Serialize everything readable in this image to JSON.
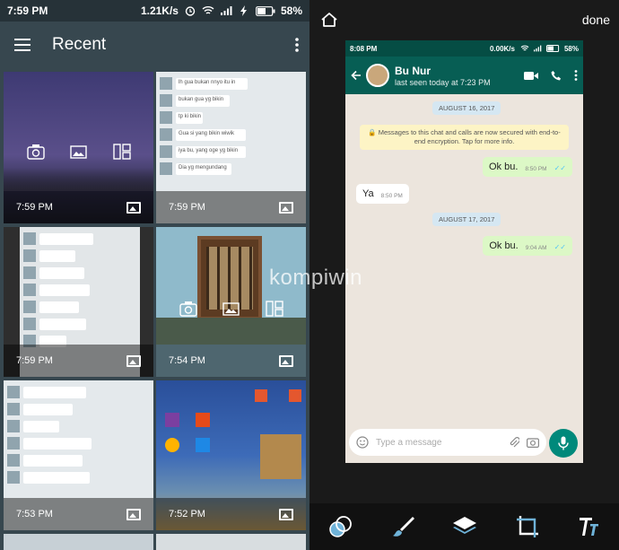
{
  "left": {
    "status": {
      "time": "7:59 PM",
      "speed": "1.21K/s",
      "battery": "58%"
    },
    "appbar": {
      "title": "Recent"
    },
    "tiles": [
      {
        "time": "7:59 PM"
      },
      {
        "time": "7:59 PM"
      },
      {
        "time": "7:59 PM"
      },
      {
        "time": "7:54 PM"
      },
      {
        "time": "7:53 PM"
      },
      {
        "time": "7:52 PM"
      }
    ],
    "thumb_chat_lines": [
      "lh gua bukan nnyo itu in",
      "bukan gua yg bikin",
      "tp ki bikin",
      "Gua si yang bikin wiwik",
      "iya bu, yang oge yg bikin",
      "Dia yg mengundang"
    ]
  },
  "right": {
    "done_label": "done",
    "phone": {
      "status_time": "8:08 PM",
      "status_speed": "0.00K/s",
      "status_battery": "58%",
      "contact_name": "Bu Nur",
      "last_seen": "last seen today at 7:23 PM",
      "date1": "AUGUST 16, 2017",
      "encryption": "Messages to this chat and calls are now secured with end-to-end encryption. Tap for more info.",
      "msg1": {
        "text": "Ok bu.",
        "time": "8:50 PM"
      },
      "msg2": {
        "text": "Ya",
        "time": "8:50 PM"
      },
      "date2": "AUGUST 17, 2017",
      "msg3": {
        "text": "Ok bu.",
        "time": "9:04 AM"
      },
      "input_placeholder": "Type a message"
    },
    "watermark": "kompiwin"
  }
}
